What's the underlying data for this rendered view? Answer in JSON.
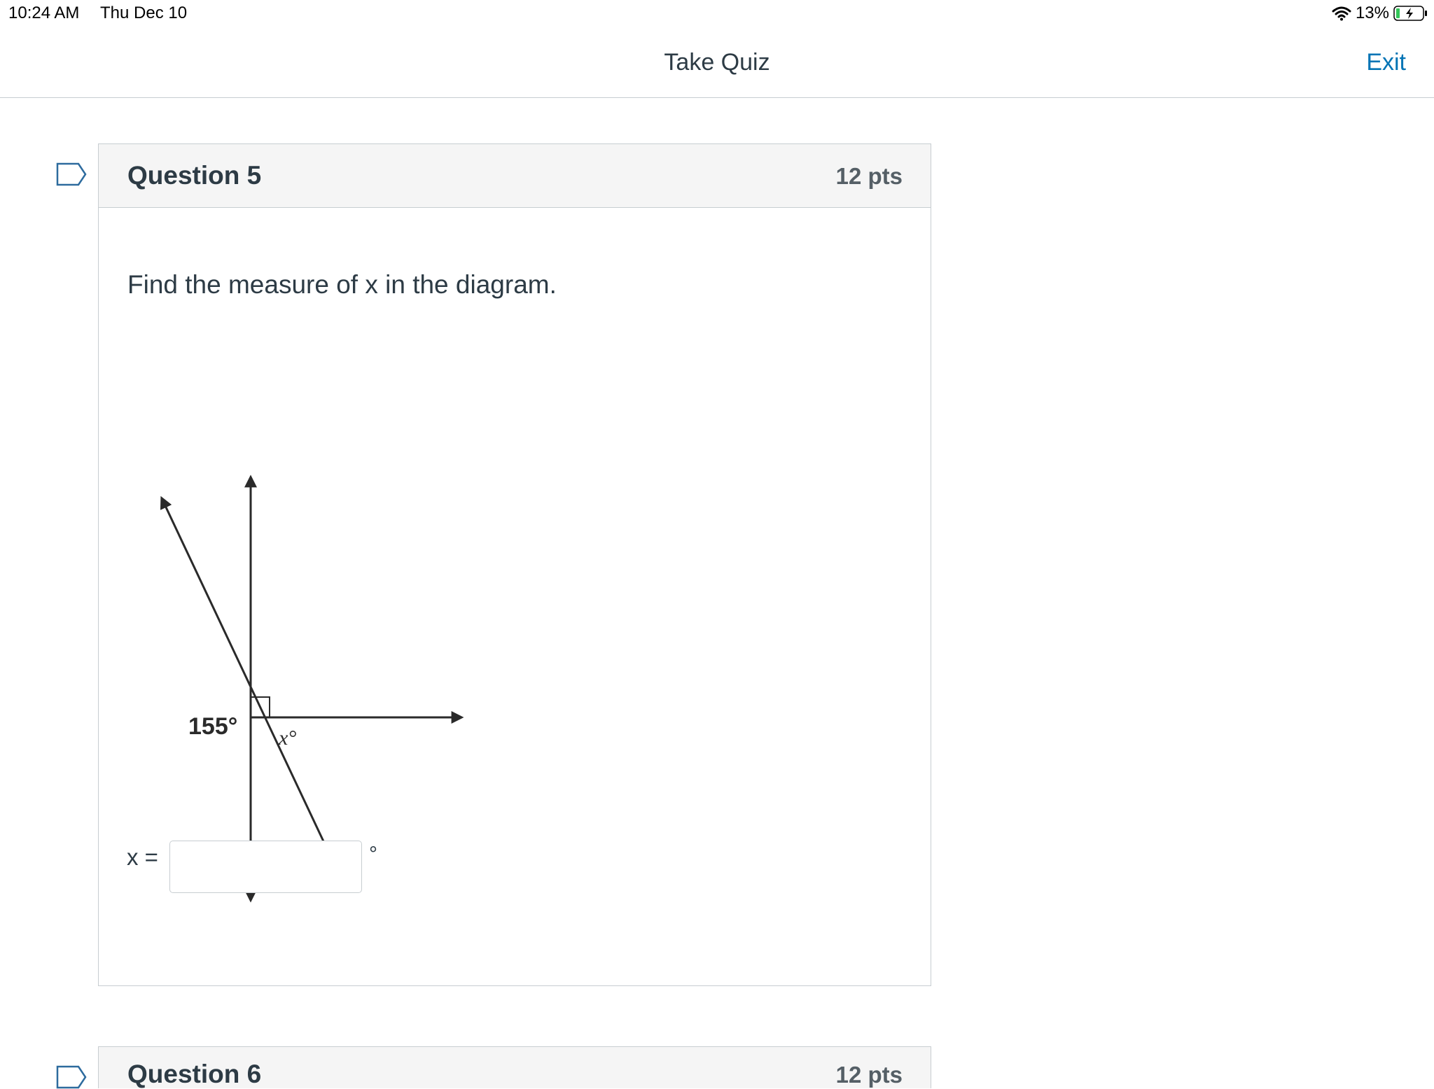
{
  "status_bar": {
    "time": "10:24 AM",
    "date": "Thu Dec 10",
    "battery_percent": "13%",
    "wifi_icon": "wifi-icon",
    "battery_icon": "battery-charging-icon"
  },
  "header": {
    "title": "Take Quiz",
    "exit_label": "Exit"
  },
  "question": {
    "title": "Question 5",
    "points": "12 pts",
    "prompt": "Find the measure of x in the diagram.",
    "flag_icon": "flag-question-icon",
    "diagram": {
      "angle_label": "155°",
      "variable_label": "x°"
    },
    "answer": {
      "label": "x =",
      "value": "",
      "unit": "°"
    }
  },
  "next_question": {
    "title": "Question 6",
    "points": "12 pts"
  },
  "colors": {
    "link": "#0374b5",
    "text": "#2d3b45",
    "border": "#c7cdd1",
    "header_bg": "#f5f5f5"
  }
}
